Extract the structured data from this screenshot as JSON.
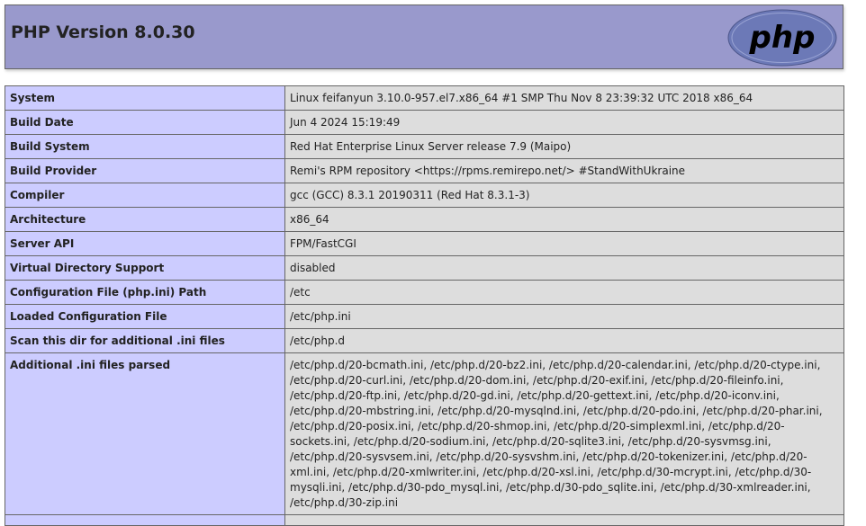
{
  "header": {
    "title": "PHP Version 8.0.30",
    "logo_text": "php"
  },
  "colors": {
    "header_bg": "#9999cc",
    "label_bg": "#ccccff",
    "value_bg": "#dddddd",
    "logo_fill": "#6c79b7",
    "logo_text": "#000000"
  },
  "rows": [
    {
      "label": "System",
      "value": "Linux feifanyun 3.10.0-957.el7.x86_64 #1 SMP Thu Nov 8 23:39:32 UTC 2018 x86_64"
    },
    {
      "label": "Build Date",
      "value": "Jun 4 2024 15:19:49"
    },
    {
      "label": "Build System",
      "value": "Red Hat Enterprise Linux Server release 7.9 (Maipo)"
    },
    {
      "label": "Build Provider",
      "value": "Remi's RPM repository <https://rpms.remirepo.net/> #StandWithUkraine"
    },
    {
      "label": "Compiler",
      "value": "gcc (GCC) 8.3.1 20190311 (Red Hat 8.3.1-3)"
    },
    {
      "label": "Architecture",
      "value": "x86_64"
    },
    {
      "label": "Server API",
      "value": "FPM/FastCGI"
    },
    {
      "label": "Virtual Directory Support",
      "value": "disabled"
    },
    {
      "label": "Configuration File (php.ini) Path",
      "value": "/etc"
    },
    {
      "label": "Loaded Configuration File",
      "value": "/etc/php.ini"
    },
    {
      "label": "Scan this dir for additional .ini files",
      "value": "/etc/php.d"
    },
    {
      "label": "Additional .ini files parsed",
      "value": "/etc/php.d/20-bcmath.ini, /etc/php.d/20-bz2.ini, /etc/php.d/20-calendar.ini, /etc/php.d/20-ctype.ini, /etc/php.d/20-curl.ini, /etc/php.d/20-dom.ini, /etc/php.d/20-exif.ini, /etc/php.d/20-fileinfo.ini, /etc/php.d/20-ftp.ini, /etc/php.d/20-gd.ini, /etc/php.d/20-gettext.ini, /etc/php.d/20-iconv.ini, /etc/php.d/20-mbstring.ini, /etc/php.d/20-mysqlnd.ini, /etc/php.d/20-pdo.ini, /etc/php.d/20-phar.ini, /etc/php.d/20-posix.ini, /etc/php.d/20-shmop.ini, /etc/php.d/20-simplexml.ini, /etc/php.d/20-sockets.ini, /etc/php.d/20-sodium.ini, /etc/php.d/20-sqlite3.ini, /etc/php.d/20-sysvmsg.ini, /etc/php.d/20-sysvsem.ini, /etc/php.d/20-sysvshm.ini, /etc/php.d/20-tokenizer.ini, /etc/php.d/20-xml.ini, /etc/php.d/20-xmlwriter.ini, /etc/php.d/20-xsl.ini, /etc/php.d/30-mcrypt.ini, /etc/php.d/30-mysqli.ini, /etc/php.d/30-pdo_mysql.ini, /etc/php.d/30-pdo_sqlite.ini, /etc/php.d/30-xmlreader.ini, /etc/php.d/30-zip.ini"
    },
    {
      "label": "",
      "value": ""
    }
  ]
}
